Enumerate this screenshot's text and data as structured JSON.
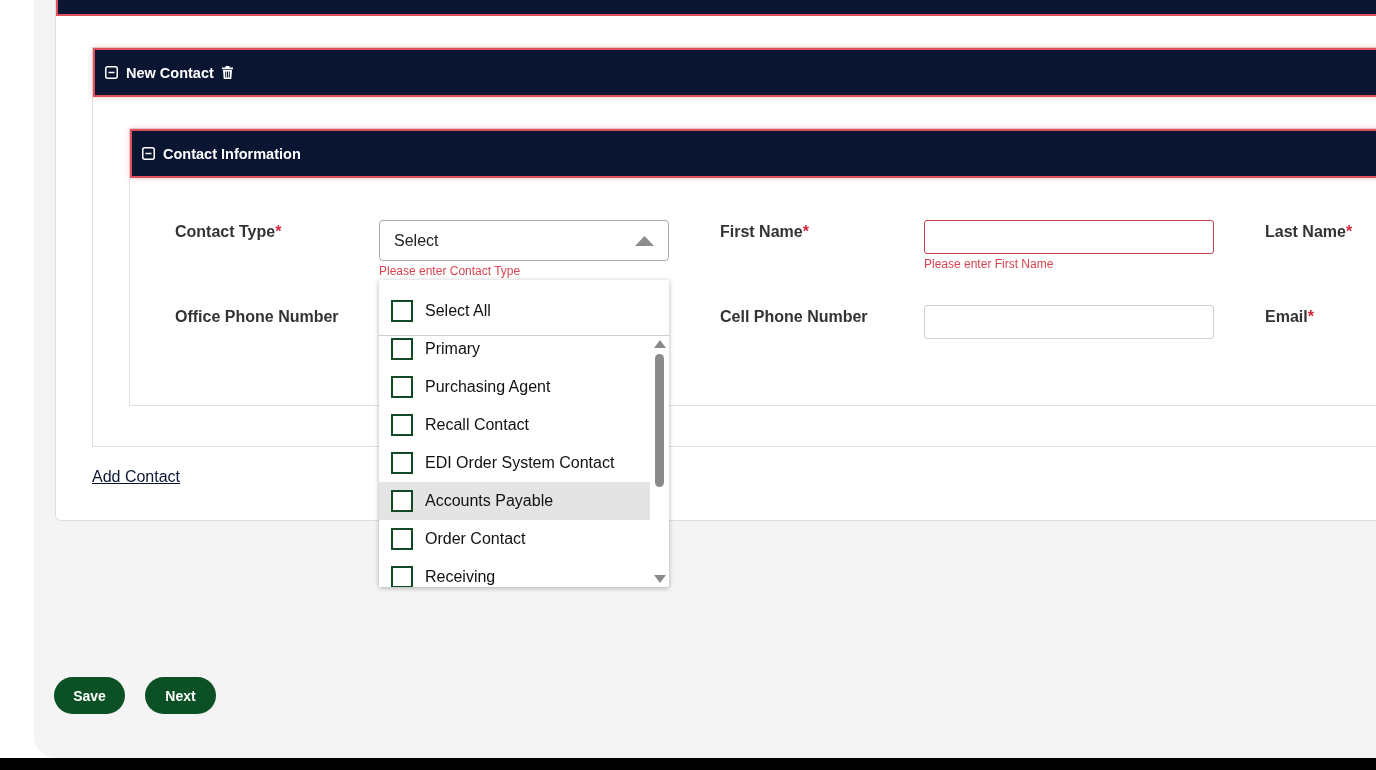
{
  "contact_section": {
    "title": "New Contact",
    "expanded": true
  },
  "info_section": {
    "title": "Contact Information",
    "expanded": true,
    "fields": [
      {
        "label": "Contact Type",
        "required_mark": "*",
        "kind": "select",
        "value": "Select",
        "error": "Please enter Contact Type",
        "open": true
      },
      {
        "label": "First Name",
        "required_mark": "*",
        "kind": "text",
        "error": "Please enter First Name",
        "invalid": true
      },
      {
        "label": "Last Name",
        "required_mark": "*",
        "kind": "label_only"
      },
      {
        "label": "Office Phone Number",
        "kind": "label_only"
      },
      {
        "label": "Cell Phone Number",
        "kind": "text",
        "invalid": false
      },
      {
        "label": "Email",
        "required_mark": "*",
        "kind": "label_only"
      }
    ]
  },
  "dropdown": {
    "select_all": {
      "label": "Select All",
      "checked": false
    },
    "options": [
      {
        "label": "Primary",
        "checked": false,
        "highlighted": false
      },
      {
        "label": "Purchasing Agent",
        "checked": false,
        "highlighted": false
      },
      {
        "label": "Recall Contact",
        "checked": false,
        "highlighted": false
      },
      {
        "label": "EDI Order System Contact",
        "checked": false,
        "highlighted": false
      },
      {
        "label": "Accounts Payable",
        "checked": false,
        "highlighted": true
      },
      {
        "label": "Order Contact",
        "checked": false,
        "highlighted": false
      },
      {
        "label": "Receiving",
        "checked": false,
        "highlighted": false
      }
    ]
  },
  "add_link": "Add Contact",
  "buttons": [
    {
      "label": "Save"
    },
    {
      "label": "Next"
    }
  ]
}
